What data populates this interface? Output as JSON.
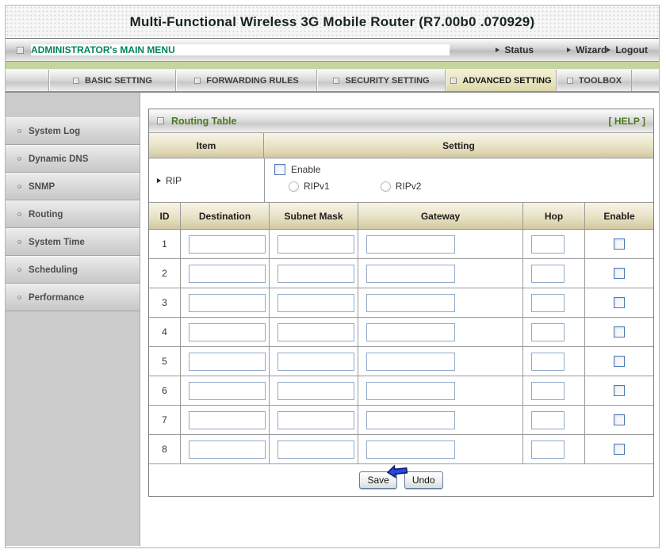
{
  "window": {
    "title": "Multi-Functional Wireless 3G Mobile Router (R7.00b0 .070929)"
  },
  "menubar": {
    "main_menu_label": "ADMINISTRATOR's MAIN MENU",
    "status_label": "Status",
    "wizard_label": "Wizard",
    "logout_label": "Logout"
  },
  "tabs": [
    {
      "label": "BASIC SETTING",
      "active": false
    },
    {
      "label": "FORWARDING RULES",
      "active": false
    },
    {
      "label": "SECURITY SETTING",
      "active": false
    },
    {
      "label": "ADVANCED SETTING",
      "active": true
    },
    {
      "label": "TOOLBOX",
      "active": false
    }
  ],
  "sidebar": {
    "items": [
      {
        "label": "System Log"
      },
      {
        "label": "Dynamic DNS"
      },
      {
        "label": "SNMP"
      },
      {
        "label": "Routing"
      },
      {
        "label": "System Time"
      },
      {
        "label": "Scheduling"
      },
      {
        "label": "Performance"
      }
    ]
  },
  "panel": {
    "title": "Routing Table",
    "help_label": "[ HELP ]",
    "header_item": "Item",
    "header_setting": "Setting",
    "rip": {
      "label": "RIP",
      "enable_label": "Enable",
      "enable_checked": false,
      "ripv1_label": "RIPv1",
      "ripv2_label": "RIPv2",
      "rip_version_selected": ""
    },
    "table": {
      "headers": [
        "ID",
        "Destination",
        "Subnet Mask",
        "Gateway",
        "Hop",
        "Enable"
      ],
      "rows": [
        {
          "id": "1",
          "destination": "",
          "subnet_mask": "",
          "gateway": "",
          "hop": "",
          "enabled": false
        },
        {
          "id": "2",
          "destination": "",
          "subnet_mask": "",
          "gateway": "",
          "hop": "",
          "enabled": false
        },
        {
          "id": "3",
          "destination": "",
          "subnet_mask": "",
          "gateway": "",
          "hop": "",
          "enabled": false
        },
        {
          "id": "4",
          "destination": "",
          "subnet_mask": "",
          "gateway": "",
          "hop": "",
          "enabled": false
        },
        {
          "id": "5",
          "destination": "",
          "subnet_mask": "",
          "gateway": "",
          "hop": "",
          "enabled": false
        },
        {
          "id": "6",
          "destination": "",
          "subnet_mask": "",
          "gateway": "",
          "hop": "",
          "enabled": false
        },
        {
          "id": "7",
          "destination": "",
          "subnet_mask": "",
          "gateway": "",
          "hop": "",
          "enabled": false
        },
        {
          "id": "8",
          "destination": "",
          "subnet_mask": "",
          "gateway": "",
          "hop": "",
          "enabled": false
        }
      ]
    },
    "save_label": "Save",
    "undo_label": "Undo"
  },
  "colors": {
    "brand_green": "#00845a",
    "panel_title_green": "#4c7a1d",
    "active_tab_bg": "#e7e3bd",
    "green_strip": "#c4d5a0",
    "input_border_blue": "#92aac8",
    "cursor_arrow_blue": "#2a46e8"
  }
}
